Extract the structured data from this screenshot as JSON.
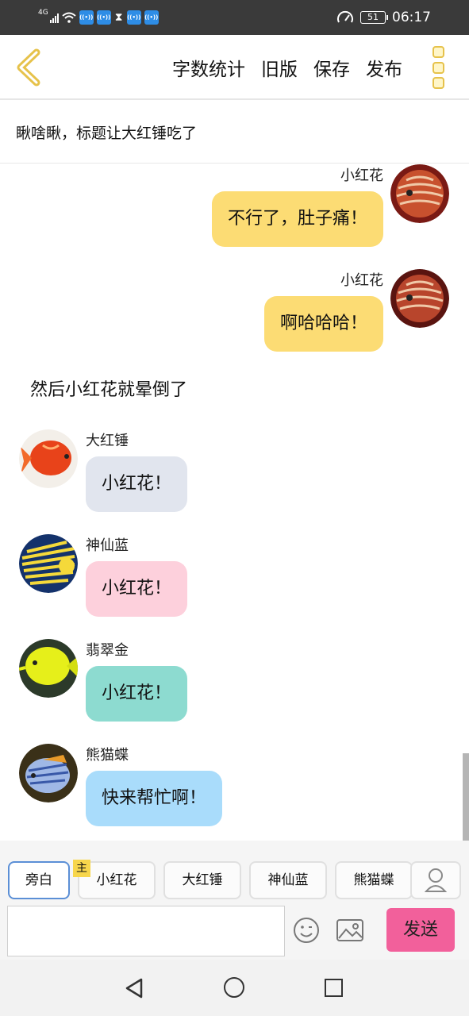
{
  "status": {
    "network": "4G",
    "battery": "51",
    "time": "06:17"
  },
  "header": {
    "actions": [
      "字数统计",
      "旧版",
      "保存",
      "发布"
    ]
  },
  "title": "瞅啥瞅，标题让大红锤吃了",
  "messages": [
    {
      "side": "right",
      "name": "小红花",
      "text": "不行了，肚子痛！",
      "bubble_color": "#fcdc74",
      "avatar": "discus-fish"
    },
    {
      "side": "right",
      "name": "小红花",
      "text": "啊哈哈哈！",
      "bubble_color": "#fcdc74",
      "avatar": "discus-fish"
    },
    {
      "side": "left",
      "name": "大红锤",
      "text": "小红花！",
      "bubble_color": "#e1e5ee",
      "avatar": "red-goldfish"
    },
    {
      "side": "left",
      "name": "神仙蓝",
      "text": "小红花！",
      "bubble_color": "#fdd0dc",
      "avatar": "angelfish"
    },
    {
      "side": "left",
      "name": "翡翠金",
      "text": "小红花！",
      "bubble_color": "#8ddbd0",
      "avatar": "yellow-tang"
    },
    {
      "side": "left",
      "name": "熊猫蝶",
      "text": "快来帮忙啊！",
      "bubble_color": "#a9dcfb",
      "avatar": "butterfly-fish"
    }
  ],
  "narration": "然后小红花就晕倒了",
  "composer": {
    "roles": [
      "旁白",
      "小红花",
      "大红锤",
      "神仙蓝",
      "熊猫蝶"
    ],
    "main_tag": "主",
    "send_label": "发送"
  },
  "colors": {
    "accent_yellow": "#e6c24a",
    "send": "#f2609b",
    "active_role": "#5b8fd6"
  }
}
